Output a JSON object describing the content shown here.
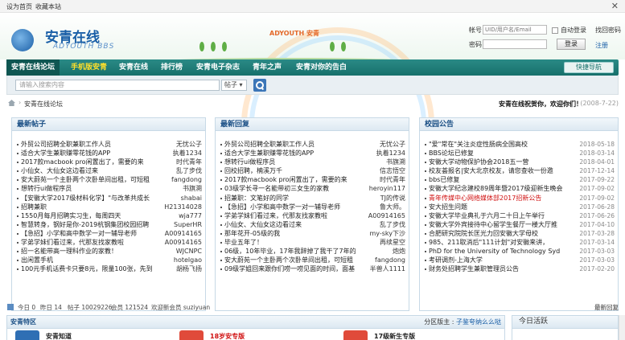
{
  "topbar": {
    "set_home": "设为首页",
    "bookmark": "收藏本站",
    "close": "✕"
  },
  "brand": {
    "name": "安青在线",
    "sub": "ADYOUTH BBS",
    "banner_text": "ADYOUTH 安青"
  },
  "login": {
    "account_label": "帐号",
    "account_placeholder": "UID/用户名/Email",
    "auto_login": "自动登录",
    "find_password": "找回密码",
    "password_label": "密码",
    "login_button": "登录",
    "register": "注册"
  },
  "nav": {
    "items": [
      "安青在线论坛",
      "手机版安青",
      "安青在线",
      "排行榜",
      "安青电子杂志",
      "青年之声",
      "安青对你的告白"
    ],
    "quick_nav": "快捷导航"
  },
  "search": {
    "placeholder": "请输入搜索内容",
    "scope": "帖子 ▾"
  },
  "breadcrumb": {
    "current": "安青在线论坛",
    "welcome": "安青在线祝贺你，欢迎你们！",
    "date": "(2008-7-22)"
  },
  "panels": {
    "latest_posts": {
      "title": "最新帖子",
      "rows": [
        {
          "t": "外贸公司招聘全职兼职工作人员",
          "a": "无忧公子"
        },
        {
          "t": "适合大学生兼职赚零花钱的APP",
          "a": "执着1234"
        },
        {
          "t": "2017款macbook pro闲置出了，需要的来",
          "a": "时代青年"
        },
        {
          "t": "小仙女、大仙女这边看过来",
          "a": "乱了步伐"
        },
        {
          "t": "安大蔚苑一个主卧两个次卧单间出租，可短租",
          "a": "fangdong"
        },
        {
          "t": "想转行ui做程序员",
          "a": "书旗溯"
        },
        {
          "t": "【安徽大学2017级材料化学】\"与改革共成长",
          "a": "shabai"
        },
        {
          "t": "招聘兼职",
          "a": "H21314028"
        },
        {
          "t": "1550月每月招聘实习生，每周四天",
          "a": "wja777"
        },
        {
          "t": "智慧转身，钢好是你-2019杭钢集团校园招聘",
          "a": "SuperHR"
        },
        {
          "t": "【急招】小学和高中数学一对一辅导老师",
          "a": "A00914165"
        },
        {
          "t": "学弟学妹们看过来，代那友找家教啦",
          "a": "A00914165"
        },
        {
          "t": "招一名能带高一理科作业的家教！",
          "a": "WJCNPC"
        },
        {
          "t": "出闲置手机",
          "a": "hotelgao"
        },
        {
          "t": "100元手机话费卡只要8元，限量100张，先到",
          "a": "胡杨飞扬"
        }
      ]
    },
    "latest_replies": {
      "title": "最新回复",
      "rows": [
        {
          "t": "外贸公司招聘全职兼职工作人员",
          "a": "无忧公子"
        },
        {
          "t": "适合大学生兼职赚零花钱的APP",
          "a": "执着1234"
        },
        {
          "t": "想转行ui做程序员",
          "a": "书旗溯"
        },
        {
          "t": "回校招聘，楠溪万千",
          "a": "信志悟空"
        },
        {
          "t": "2017款macbook pro闲置出了，需要的来",
          "a": "时代青年"
        },
        {
          "t": "03级学长寻一名能带初三女生的家教",
          "a": "heroyin117"
        },
        {
          "t": "招兼职：文笔好的同学",
          "a": "TJ的传说"
        },
        {
          "t": "【急招】小学和高中数学一对一辅导老师",
          "a": "鲁大师。"
        },
        {
          "t": "学弟学妹们看过来，代那友找家教啦",
          "a": "A00914165"
        },
        {
          "t": "小仙女、大仙女这边看过来",
          "a": "乱了步伐"
        },
        {
          "t": "那年花开-05级的我",
          "a": "my-sky下沙"
        },
        {
          "t": "毕业五年了！",
          "a": "再续星空"
        },
        {
          "t": "06级，10年毕业，17年我辞掉了我干了7年的",
          "a": "炮炮"
        },
        {
          "t": "安大蔚苑一个主卧两个次卧单间出租，可短租",
          "a": "fangdong"
        },
        {
          "t": "09级学姐回来跟你们唠一唠见面的时间，面基",
          "a": "半兽人1111"
        }
      ]
    },
    "announcements": {
      "title": "校园公告",
      "rows": [
        {
          "t": "\"爱\"常在\"关注炎症性肠病全国高校",
          "d": "2018-05-18",
          "red": false
        },
        {
          "t": "BBS论坛已修复",
          "d": "2018-03-14",
          "red": false
        },
        {
          "t": "安徽大学动物保护协会2018五一营",
          "d": "2018-04-01",
          "red": false
        },
        {
          "t": "校友荟报名|安大北京校友，请您查收一份邀",
          "d": "2017-12-14",
          "red": false
        },
        {
          "t": "bbs已修复",
          "d": "2017-09-22",
          "red": false
        },
        {
          "t": "安徽大学纪念建校89周年暨2017级迎新生晚会",
          "d": "2017-09-02",
          "red": false
        },
        {
          "t": "青年传媒中心网络媒体部2017招新公告",
          "d": "2017-09-02",
          "red": true
        },
        {
          "t": "安大招生问题",
          "d": "2017-06-28",
          "red": false
        },
        {
          "t": "安徽大学毕业典礼于六月二十日上午举行",
          "d": "2017-06-26",
          "red": false
        },
        {
          "t": "安徽大学外宾接待中心留学生餐厅一楼大厅推",
          "d": "2017-04-10",
          "red": false
        },
        {
          "t": "合肥研究院院长匡光力回安徽大学母校",
          "d": "2017-03-28",
          "red": false
        },
        {
          "t": "985、211取消后\"111计划\"对安徽来讲，",
          "d": "2017-03-14",
          "red": false
        },
        {
          "t": "PhD for the University of Technology Syd",
          "d": "2017-03-03",
          "red": false
        },
        {
          "t": "考研调剂-上海大学",
          "d": "2017-03-03",
          "red": false
        },
        {
          "t": "财务处招聘学生兼职管理员公告",
          "d": "2017-02-20",
          "red": false
        }
      ]
    }
  },
  "stats": {
    "today": "今日 0",
    "yesterday": "昨日 14",
    "posts": "帖子 10029226",
    "members": "会员 121524",
    "newest_member": "欢迎新会员 suziyuan",
    "latest_replies_link": "最新回复"
  },
  "zone": {
    "title": "安青特区",
    "moderator": "分区版主 :",
    "moderator_name": "子鉴夸纳么么哒",
    "forums": [
      "安青知道",
      "18岁安专版",
      "17级新生专版"
    ]
  },
  "today_panel": {
    "title": "今日活跃"
  }
}
